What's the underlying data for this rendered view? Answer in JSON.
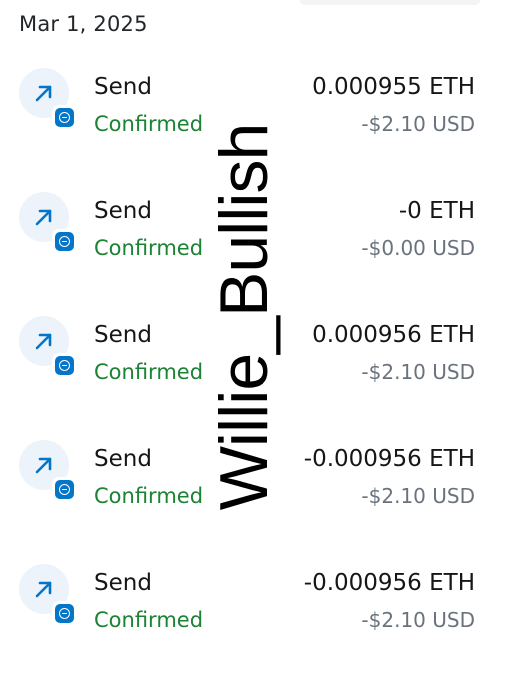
{
  "header": {
    "date": "Mar 1, 2025"
  },
  "colors": {
    "confirmed": "#1c8234",
    "accent": "#0376c9",
    "icon_bg": "#edf3fa",
    "secondary_text": "#6a737d"
  },
  "icons": {
    "direction": "arrow-up-right-icon",
    "network_badge": "network-badge-icon"
  },
  "transactions": [
    {
      "type": "Send",
      "status": "Confirmed",
      "amount": "0.000955 ETH",
      "fiat": "-$2.10 USD"
    },
    {
      "type": "Send",
      "status": "Confirmed",
      "amount": "-0 ETH",
      "fiat": "-$0.00 USD"
    },
    {
      "type": "Send",
      "status": "Confirmed",
      "amount": "0.000956 ETH",
      "fiat": "-$2.10 USD"
    },
    {
      "type": "Send",
      "status": "Confirmed",
      "amount": "-0.000956 ETH",
      "fiat": "-$2.10 USD"
    },
    {
      "type": "Send",
      "status": "Confirmed",
      "amount": "-0.000956 ETH",
      "fiat": "-$2.10 USD"
    }
  ],
  "watermark": {
    "text": "Willie_Bullish"
  }
}
